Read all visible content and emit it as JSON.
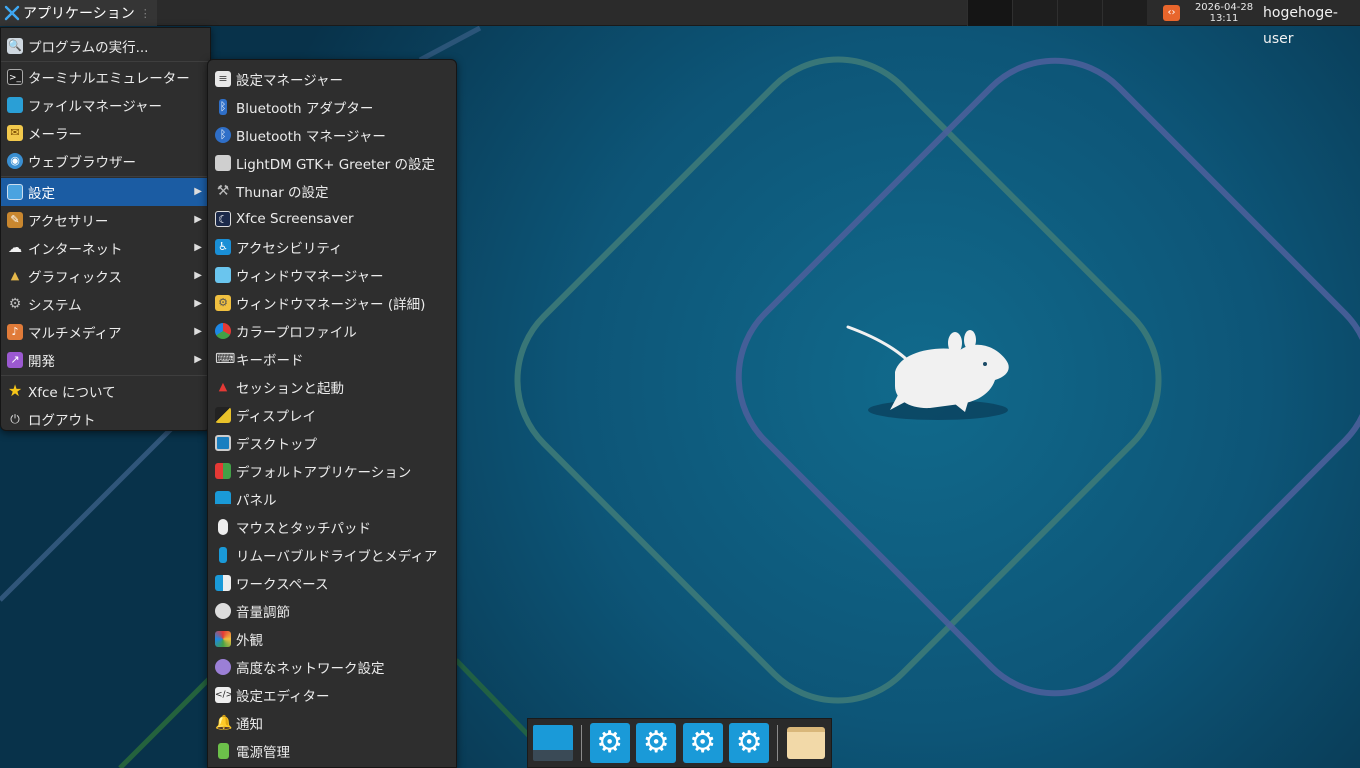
{
  "top_panel": {
    "apps_button_label": "アプリケーション",
    "clock_date": "2026-04-28",
    "clock_time": "13:11",
    "user_name": "hogehoge-user"
  },
  "main_menu": {
    "items": [
      {
        "label": "プログラムの実行...",
        "icon": "run-program-icon"
      },
      {
        "label": "ターミナルエミュレーター",
        "icon": "terminal-icon"
      },
      {
        "label": "ファイルマネージャー",
        "icon": "file-manager-icon"
      },
      {
        "label": "メーラー",
        "icon": "mail-icon"
      },
      {
        "label": "ウェブブラウザー",
        "icon": "web-browser-icon"
      },
      {
        "label": "設定",
        "icon": "settings-icon"
      },
      {
        "label": "アクセサリー",
        "icon": "accessories-icon"
      },
      {
        "label": "インターネット",
        "icon": "internet-icon"
      },
      {
        "label": "グラフィックス",
        "icon": "graphics-icon"
      },
      {
        "label": "システム",
        "icon": "system-icon"
      },
      {
        "label": "マルチメディア",
        "icon": "multimedia-icon"
      },
      {
        "label": "開発",
        "icon": "development-icon"
      },
      {
        "label": "Xfce について",
        "icon": "star-icon"
      },
      {
        "label": "ログアウト",
        "icon": "logout-icon"
      }
    ]
  },
  "settings_menu": {
    "items": [
      {
        "label": "設定マネージャー"
      },
      {
        "label": "Bluetooth アダプター"
      },
      {
        "label": "Bluetooth マネージャー"
      },
      {
        "label": "LightDM GTK+ Greeter の設定"
      },
      {
        "label": "Thunar の設定"
      },
      {
        "label": "Xfce Screensaver"
      },
      {
        "label": "アクセシビリティ"
      },
      {
        "label": "ウィンドウマネージャー"
      },
      {
        "label": "ウィンドウマネージャー (詳細)"
      },
      {
        "label": "カラープロファイル"
      },
      {
        "label": "キーボード"
      },
      {
        "label": "セッションと起動"
      },
      {
        "label": "ディスプレイ"
      },
      {
        "label": "デスクトップ"
      },
      {
        "label": "デフォルトアプリケーション"
      },
      {
        "label": "パネル"
      },
      {
        "label": "マウスとタッチパッド"
      },
      {
        "label": "リムーバブルドライブとメディア"
      },
      {
        "label": "ワークスペース"
      },
      {
        "label": "音量調節"
      },
      {
        "label": "外観"
      },
      {
        "label": "高度なネットワーク設定"
      },
      {
        "label": "設定エディター"
      },
      {
        "label": "通知"
      },
      {
        "label": "電源管理"
      }
    ]
  },
  "dock": {
    "items": [
      "show-desktop-icon",
      "settings-gear-icon",
      "settings-gear-icon",
      "settings-gear-icon",
      "settings-gear-icon",
      "folder-icon"
    ]
  },
  "colors": {
    "highlight": "#1b5ca3",
    "menu_bg": "#2e2e2e",
    "panel_bg": "#2b2b2b",
    "desktop_bg": "#0b3c52"
  }
}
